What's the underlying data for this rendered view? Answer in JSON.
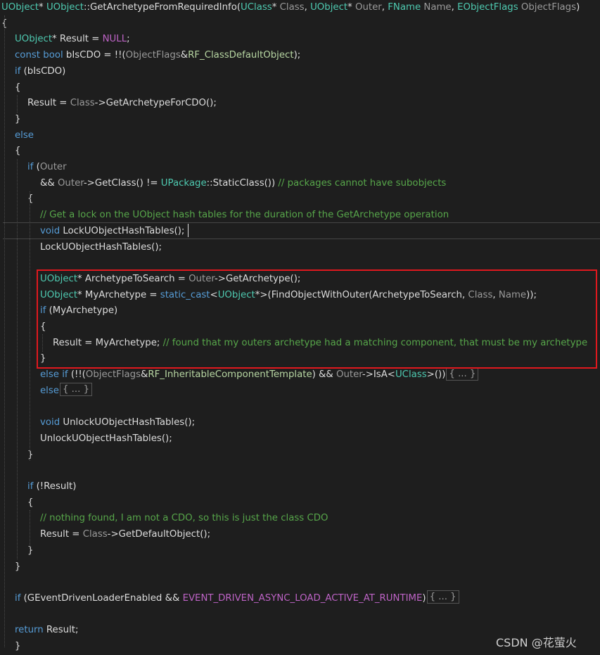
{
  "code_lines": [
    [
      [
        "t-type",
        "UObject"
      ],
      [
        "t-punc",
        "* "
      ],
      [
        "t-type",
        "UObject"
      ],
      [
        "t-punc",
        "::GetArchetypeFromRequiredInfo("
      ],
      [
        "t-type",
        "UClass"
      ],
      [
        "t-punc",
        "* "
      ],
      [
        "t-param",
        "Class"
      ],
      [
        "t-punc",
        ", "
      ],
      [
        "t-type",
        "UObject"
      ],
      [
        "t-punc",
        "* "
      ],
      [
        "t-param",
        "Outer"
      ],
      [
        "t-punc",
        ", "
      ],
      [
        "t-type",
        "FName"
      ],
      [
        "t-punc",
        " "
      ],
      [
        "t-param",
        "Name"
      ],
      [
        "t-punc",
        ", "
      ],
      [
        "t-type",
        "EObjectFlags"
      ],
      [
        "t-punc",
        " "
      ],
      [
        "t-param",
        "ObjectFlags"
      ],
      [
        "t-punc",
        ")"
      ]
    ],
    [
      [
        "t-punc",
        "{"
      ]
    ],
    [
      [
        "t-type",
        "UObject"
      ],
      [
        "t-punc",
        "* Result = "
      ],
      [
        "t-macro",
        "NULL"
      ],
      [
        "t-punc",
        ";"
      ]
    ],
    [
      [
        "t-kw",
        "const"
      ],
      [
        "t-punc",
        " "
      ],
      [
        "t-kw",
        "bool"
      ],
      [
        "t-punc",
        " bIsCDO = !!("
      ],
      [
        "t-param",
        "ObjectFlags"
      ],
      [
        "t-punc",
        "&"
      ],
      [
        "t-enum",
        "RF_ClassDefaultObject"
      ],
      [
        "t-punc",
        ");"
      ]
    ],
    [
      [
        "t-kw",
        "if"
      ],
      [
        "t-punc",
        " (bIsCDO)"
      ]
    ],
    [
      [
        "t-punc",
        "{"
      ]
    ],
    [
      [
        "t-punc",
        "Result = "
      ],
      [
        "t-param",
        "Class"
      ],
      [
        "t-punc",
        "->GetArchetypeForCDO();"
      ]
    ],
    [
      [
        "t-punc",
        "}"
      ]
    ],
    [
      [
        "t-kw",
        "else"
      ]
    ],
    [
      [
        "t-punc",
        "{"
      ]
    ],
    [
      [
        "t-kw",
        "if"
      ],
      [
        "t-punc",
        " ("
      ],
      [
        "t-param",
        "Outer"
      ]
    ],
    [
      [
        "t-punc",
        "&& "
      ],
      [
        "t-param",
        "Outer"
      ],
      [
        "t-punc",
        "->GetClass() != "
      ],
      [
        "t-type",
        "UPackage"
      ],
      [
        "t-punc",
        "::StaticClass()) "
      ],
      [
        "t-cmt",
        "// packages cannot have subobjects"
      ]
    ],
    [
      [
        "t-punc",
        "{"
      ]
    ],
    [
      [
        "t-cmt",
        "// Get a lock on the UObject hash tables for the duration of the GetArchetype operation"
      ]
    ],
    [
      [
        "t-kw",
        "void"
      ],
      [
        "t-punc",
        " LockUObjectHashTables();"
      ]
    ],
    [
      [
        "t-punc",
        "LockUObjectHashTables();"
      ]
    ],
    [],
    [
      [
        "t-type",
        "UObject"
      ],
      [
        "t-punc",
        "* ArchetypeToSearch = "
      ],
      [
        "t-param",
        "Outer"
      ],
      [
        "t-punc",
        "->GetArchetype();"
      ]
    ],
    [
      [
        "t-type",
        "UObject"
      ],
      [
        "t-punc",
        "* MyArchetype = "
      ],
      [
        "t-kw",
        "static_cast"
      ],
      [
        "t-punc",
        "<"
      ],
      [
        "t-type",
        "UObject"
      ],
      [
        "t-punc",
        "*>(FindObjectWithOuter(ArchetypeToSearch, "
      ],
      [
        "t-param",
        "Class"
      ],
      [
        "t-punc",
        ", "
      ],
      [
        "t-param",
        "Name"
      ],
      [
        "t-punc",
        "));"
      ]
    ],
    [
      [
        "t-kw",
        "if"
      ],
      [
        "t-punc",
        " (MyArchetype)"
      ]
    ],
    [
      [
        "t-punc",
        "{"
      ]
    ],
    [
      [
        "t-punc",
        "Result = MyArchetype; "
      ],
      [
        "t-cmt",
        "// found that my outers archetype had a matching component, that must be my archetype"
      ]
    ],
    [
      [
        "t-punc",
        "}"
      ]
    ],
    [
      [
        "t-kw",
        "else"
      ],
      [
        "t-punc",
        " "
      ],
      [
        "t-kw",
        "if"
      ],
      [
        "t-punc",
        " (!!("
      ],
      [
        "t-param",
        "ObjectFlags"
      ],
      [
        "t-punc",
        "&"
      ],
      [
        "t-enum",
        "RF_InheritableComponentTemplate"
      ],
      [
        "t-punc",
        ") && "
      ],
      [
        "t-param",
        "Outer"
      ],
      [
        "t-punc",
        "->IsA<"
      ],
      [
        "t-type",
        "UClass"
      ],
      [
        "t-punc",
        ">())"
      ],
      [
        "fold",
        "{ ... }"
      ]
    ],
    [
      [
        "t-kw",
        "else"
      ],
      [
        "fold",
        "{ ... }"
      ]
    ],
    [],
    [
      [
        "t-kw",
        "void"
      ],
      [
        "t-punc",
        " UnlockUObjectHashTables();"
      ]
    ],
    [
      [
        "t-punc",
        "UnlockUObjectHashTables();"
      ]
    ],
    [
      [
        "t-punc",
        "}"
      ]
    ],
    [],
    [
      [
        "t-kw",
        "if"
      ],
      [
        "t-punc",
        " (!Result)"
      ]
    ],
    [
      [
        "t-punc",
        "{"
      ]
    ],
    [
      [
        "t-cmt",
        "// nothing found, I am not a CDO, so this is just the class CDO"
      ]
    ],
    [
      [
        "t-punc",
        "Result = "
      ],
      [
        "t-param",
        "Class"
      ],
      [
        "t-punc",
        "->GetDefaultObject();"
      ]
    ],
    [
      [
        "t-punc",
        "}"
      ]
    ],
    [
      [
        "t-punc",
        "}"
      ]
    ],
    [],
    [
      [
        "t-kw",
        "if"
      ],
      [
        "t-punc",
        " (GEventDrivenLoaderEnabled && "
      ],
      [
        "t-macro",
        "EVENT_DRIVEN_ASYNC_LOAD_ACTIVE_AT_RUNTIME"
      ],
      [
        "t-punc",
        ")"
      ],
      [
        "fold",
        "{ ... }"
      ]
    ],
    [],
    [
      [
        "t-kw",
        "return"
      ],
      [
        "t-punc",
        " Result;"
      ]
    ],
    [
      [
        "t-punc",
        "}"
      ]
    ]
  ],
  "watermark": "CSDN @花萤火"
}
